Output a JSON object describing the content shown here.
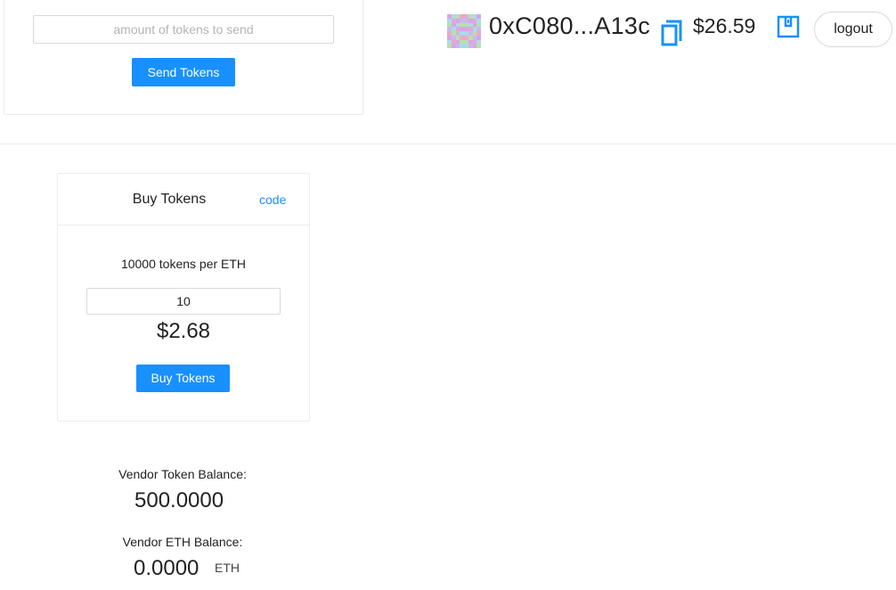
{
  "send": {
    "placeholder": "amount of tokens to send",
    "button_label": "Send Tokens"
  },
  "account": {
    "address": "0xC080...A13c",
    "balance": "$26.59",
    "logout_label": "logout",
    "copy_icon": "copy-icon",
    "wallet_icon": "wallet-icon"
  },
  "buy": {
    "title": "Buy Tokens",
    "code_link": "code",
    "rate_text": "10000 tokens per ETH",
    "amount_value": "10",
    "cost": "$2.68",
    "button_label": "Buy Tokens"
  },
  "vendor": {
    "token_label": "Vendor Token Balance:",
    "token_value": "500.0000",
    "eth_label": "Vendor ETH Balance:",
    "eth_value": "0.0000",
    "eth_unit": "ETH"
  },
  "colors": {
    "accent": "#1890ff",
    "border": "#ececec"
  }
}
